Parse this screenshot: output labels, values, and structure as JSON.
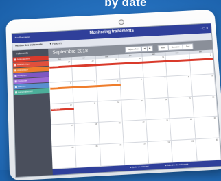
{
  "headline": "by date",
  "app": {
    "title": "Monitoring traitements",
    "logo": "Bon Pharmacien",
    "window_buttons": "– ▢ ✕"
  },
  "subbar": {
    "label": "Gestion des traitements",
    "patient": "▼ Patient 1"
  },
  "sidebar": {
    "heading": "Traitements",
    "items": [
      {
        "label": "Anticoagulant",
        "color": "#d93a2b"
      },
      {
        "label": "Antidiabétique",
        "color": "#e0503c"
      },
      {
        "label": "Antibiotique",
        "color": "#ef7d2c"
      },
      {
        "label": "Antalgique",
        "color": "#7e57c2"
      },
      {
        "label": "Corticoïde",
        "color": "#9c6ad6"
      },
      {
        "label": "Vitamine",
        "color": "#5a8fd0"
      },
      {
        "label": "Autre traitement",
        "color": "#4caf9a"
      }
    ]
  },
  "calendar": {
    "month": "Septembre 2018",
    "today_label": "Aujourd'hui",
    "prev_label": "◀",
    "next_label": "▶",
    "mois_label": "Mois",
    "semaine_label": "Semaine",
    "jour_label": "Jour",
    "days": [
      "lun.",
      "mar.",
      "mer.",
      "jeu.",
      "ven.",
      "sam.",
      "dim."
    ],
    "weeks": [
      [
        "27",
        "28",
        "29",
        "30",
        "31",
        "1",
        "2"
      ],
      [
        "3",
        "4",
        "5",
        "6",
        "7",
        "8",
        "9"
      ],
      [
        "10",
        "11",
        "12",
        "13",
        "14",
        "15",
        "16"
      ],
      [
        "17",
        "18",
        "19",
        "20",
        "21",
        "22",
        "23"
      ],
      [
        "24",
        "25",
        "26",
        "27",
        "28",
        "29",
        "30"
      ]
    ],
    "events": [
      {
        "label": "Anticoagulant",
        "color": "#d93a2b",
        "week": 0,
        "start": 0,
        "span": 7
      },
      {
        "label": "Antibiotique",
        "color": "#ef7d2c",
        "week": 1,
        "start": 0,
        "span": 3
      },
      {
        "label": "Anticoagulant",
        "color": "#d93a2b",
        "week": 2,
        "start": 0,
        "span": 1
      }
    ]
  },
  "footer": {
    "left": "● Ajouter un traitement",
    "right": "● Calendrier des traitements"
  }
}
